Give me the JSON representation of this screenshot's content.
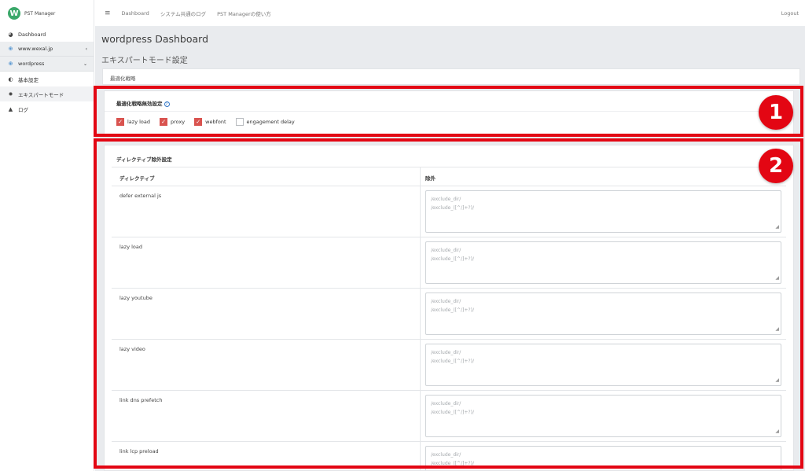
{
  "app": {
    "name": "PST Manager",
    "logo_letter": "W"
  },
  "sidebar": {
    "items": [
      {
        "label": "Dashboard",
        "icon": "dashboard-icon"
      },
      {
        "label": "www.wexal.jp",
        "icon": "globe-icon",
        "caret": "‹"
      },
      {
        "label": "wordpress",
        "icon": "globe-icon",
        "caret": "⌄"
      },
      {
        "label": "基本設定",
        "icon": "toggle-icon"
      },
      {
        "label": "エキスパートモード",
        "icon": "gear-icon"
      },
      {
        "label": "ログ",
        "icon": "warning-icon"
      }
    ]
  },
  "topbar": {
    "links": [
      "Dashboard",
      "システム共通のログ",
      "PST Managerの使い方"
    ],
    "logout": "Logout"
  },
  "main": {
    "title": "wordpress Dashboard",
    "subtitle": "エキスパートモード設定",
    "tab": "最適化戦略"
  },
  "optimization_disable": {
    "header": "最適化戦略無効設定",
    "options": [
      {
        "label": "lazy load",
        "checked": true
      },
      {
        "label": "proxy",
        "checked": true
      },
      {
        "label": "webfont",
        "checked": true
      },
      {
        "label": "engagement delay",
        "checked": false
      }
    ]
  },
  "directive_exclude": {
    "header": "ディレクティブ除外設定",
    "columns": [
      "ディレクティブ",
      "除外"
    ],
    "placeholder_line1": "/exclude_dir/",
    "placeholder_line2": "/exclude_([^/]+?)/",
    "rows": [
      "defer external js",
      "lazy load",
      "lazy youtube",
      "lazy video",
      "link dns prefetch",
      "link lcp preload"
    ]
  },
  "annotations": {
    "badge1": "1",
    "badge2": "2",
    "color": "#e30613"
  },
  "colors": {
    "accent": "#d9534f",
    "brand": "#3ba86a",
    "link": "#3578c7"
  }
}
